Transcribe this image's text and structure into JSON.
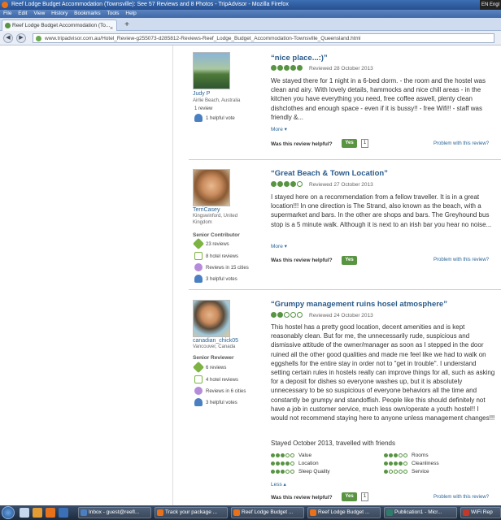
{
  "window": {
    "title": "Reef Lodge Budget Accommodation (Townsville): See 57 Reviews and 8 Photos - TripAdvisor - Mozilla Firefox",
    "lang": "EN Engl"
  },
  "menu": [
    "File",
    "Edit",
    "View",
    "History",
    "Bookmarks",
    "Tools",
    "Help"
  ],
  "tab": {
    "label": "Reef Lodge Budget Accommodation (To...",
    "close": "×",
    "new": "+"
  },
  "nav": {
    "back": "◀",
    "forward": "▶",
    "url": "www.tripadvisor.com.au/Hotel_Review-g255073-d285812-Reviews-Reef_Lodge_Budget_Accommodation-Townsville_Queensland.html"
  },
  "reviews": [
    {
      "user": "Judy P",
      "location": "Airlie Beach, Australia",
      "stats": [
        "1 review",
        "1 helpful vote"
      ],
      "title": "“nice place...:)”",
      "rating": 5,
      "date": "Reviewed 28 October 2013",
      "body": "We stayed there for 1 night in a 6-bed dorm. - the room and the hostel was clean and airy. With lovely details, hammocks and nice chill areas - in the kitchen you have everything you need, free coffee aswell, plenty clean dishclothes and enough space - even if it is bussy!! - free Wifi!! - staff was friendly &...",
      "more": "More ▾",
      "helpful_q": "Was this review helpful?",
      "yes": "Yes",
      "count": "1",
      "problem": "Problem with this review?"
    },
    {
      "user": "TerriCasey",
      "location": "Kingswinford, United Kingdom",
      "level": "Senior Contributor",
      "stats": [
        "23 reviews",
        "8 hotel reviews",
        "Reviews in 15 cities",
        "3 helpful votes"
      ],
      "title": "“Great Beach & Town Location”",
      "rating": 4,
      "date": "Reviewed 27 October 2013",
      "body": "I stayed here on a recommendation from a fellow traveller. It is in a great location!!! In one direction is The Strand, also known as the beach, with a supermarket and bars. In the other are shops and bars. The Greyhound bus stop is a 5 minute walk. Although it is next to an irish bar you hear no noise...",
      "more": "More ▾",
      "helpful_q": "Was this review helpful?",
      "yes": "Yes",
      "problem": "Problem with this review?"
    },
    {
      "user": "canadian_chick05",
      "location": "Vancouver, Canada",
      "level": "Senior Reviewer",
      "stats": [
        "6 reviews",
        "4 hotel reviews",
        "Reviews in 6 cities",
        "3 helpful votes"
      ],
      "title": "“Grumpy management ruins hosel atmosphere”",
      "rating": 2,
      "date": "Reviewed 24 October 2013",
      "body": "This hostel has a pretty good location, decent amenities and is kept reasonably clean. But for me, the unnecessarily rude, suspicious and dismissive attitude of the owner/manager as soon as I stepped in the door ruined all the other good qualities and made me feel like we had to walk on eggshells for the entire stay in order not to \"get in trouble\". I understand setting certain rules in hostels really can improve things for all, such as asking for a deposit for dishes so everyone washes up, but it is absolutely unnecessary to be so suspicious of everyone behaviors all the time and constantly be grumpy and standoffish. People like this should definitely not have a job in customer service, much less own/operate a youth hostel!! I would not recommend staying here to anyone unless management changes!!!",
      "stayed": "Stayed October 2013, travelled with friends",
      "subratings": [
        {
          "label": "Value",
          "rating": 3
        },
        {
          "label": "Location",
          "rating": 4
        },
        {
          "label": "Sleep Quality",
          "rating": 3
        },
        {
          "label": "Rooms",
          "rating": 3
        },
        {
          "label": "Cleanliness",
          "rating": 4
        },
        {
          "label": "Service",
          "rating": 1
        }
      ],
      "less": "Less ▴",
      "helpful_q": "Was this review helpful?",
      "yes": "Yes",
      "count": "1",
      "problem": "Problem with this review?"
    }
  ],
  "taskbar": {
    "items": [
      "Inbox - guest@reefl...",
      "Track your package ...",
      "Reef Lodge Budget ...",
      "Reef Lodge Budget ...",
      "Publication1 - Micr...",
      "WiFi Rep"
    ]
  },
  "colors": {
    "accent": "#589442",
    "link": "#2a6496",
    "title_bar": "#2d5a9b"
  }
}
